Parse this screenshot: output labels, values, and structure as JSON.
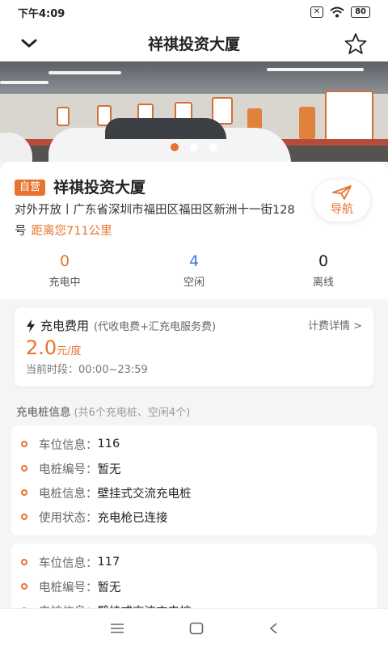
{
  "status_bar": {
    "time": "下午4:09",
    "battery": "80"
  },
  "nav": {
    "title": "祥祺投资大厦"
  },
  "carousel": {
    "dot_count": 3,
    "active_index": 0
  },
  "station": {
    "tag": "自营",
    "name": "祥祺投资大厦",
    "address": "对外开放丨广东省深圳市福田区福田区新洲十一街128号",
    "distance": "距离您711公里",
    "navigate_label": "导航"
  },
  "stats": [
    {
      "value": "0",
      "label": "充电中",
      "color": "#e8732c"
    },
    {
      "value": "4",
      "label": "空闲",
      "color": "#3b7fd4"
    },
    {
      "value": "0",
      "label": "离线",
      "color": "#222222"
    }
  ],
  "fee": {
    "title": "充电费用",
    "subtitle": "(代收电费+汇充电服务费)",
    "detail_link": "计费详情 >",
    "price": "2.0",
    "unit": "元/度",
    "period": "当前时段：00:00~23:59"
  },
  "piles_section": {
    "title": "充电桩信息",
    "subtitle": "(共6个充电桩、空闲4个)"
  },
  "piles": [
    {
      "rows": [
        {
          "key": "车位信息：",
          "value": "116"
        },
        {
          "key": "电桩编号：",
          "value": "暂无"
        },
        {
          "key": "电桩信息：",
          "value": "壁挂式交流充电桩"
        },
        {
          "key": "使用状态：",
          "value": "充电枪已连接"
        }
      ]
    },
    {
      "rows": [
        {
          "key": "车位信息：",
          "value": "117"
        },
        {
          "key": "电桩编号：",
          "value": "暂无"
        },
        {
          "key": "电桩信息：",
          "value": "壁挂式交流充电桩"
        }
      ]
    }
  ],
  "colors": {
    "accent": "#e8732c",
    "blue": "#3b7fd4"
  }
}
